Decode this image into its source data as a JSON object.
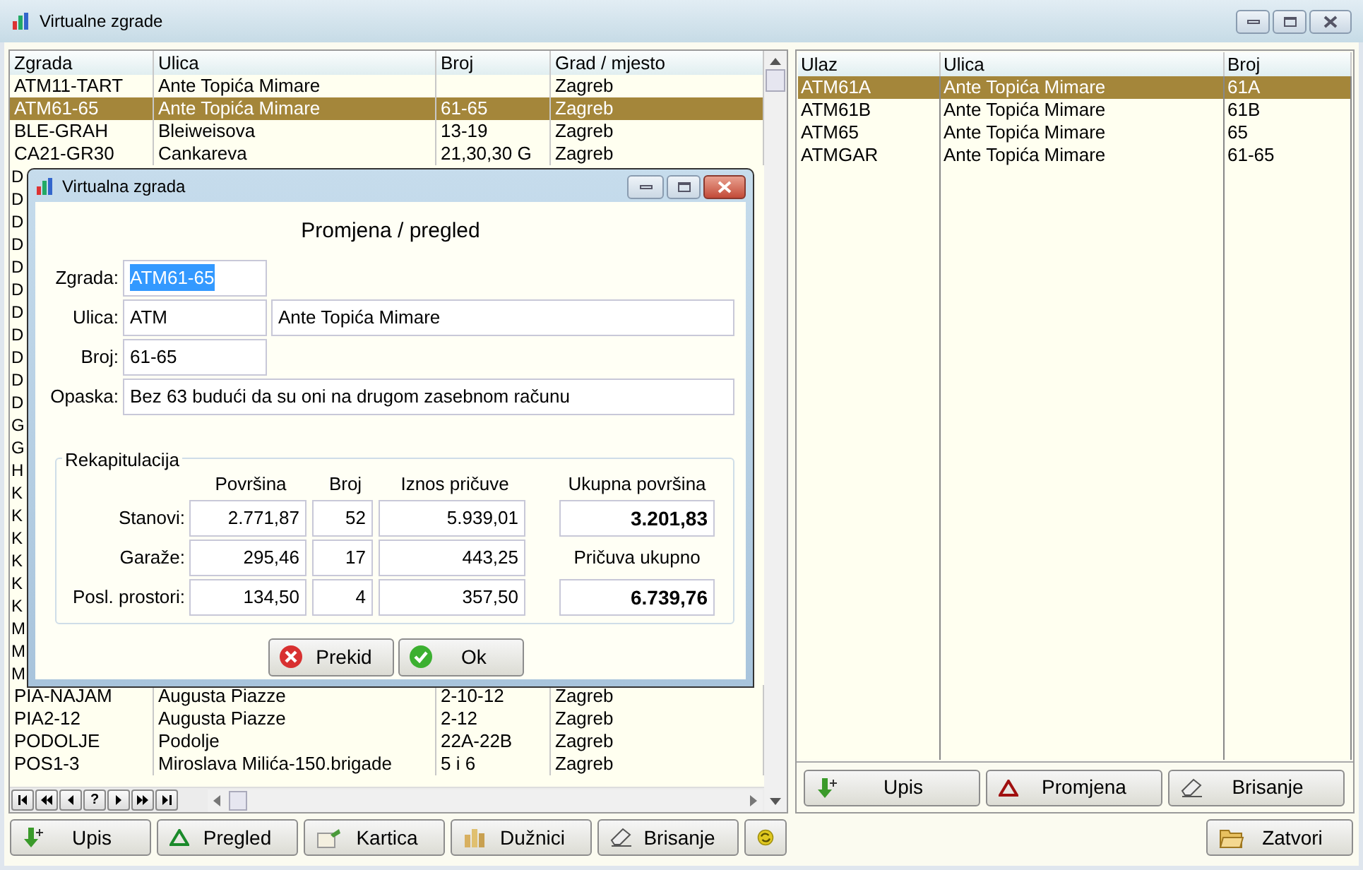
{
  "window": {
    "title": "Virtualne zgrade"
  },
  "buildings": {
    "columns": [
      "Zgrada",
      "Ulica",
      "Broj",
      "Grad / mjesto"
    ],
    "rows": [
      {
        "zgrada": "ATM11-TART",
        "ulica": "Ante Topića Mimare",
        "grad": "Zagreb",
        "selected": false
      },
      {
        "zgrada": "ATM61-65",
        "ulica": "Ante Topića Mimare",
        "broj": "61-65",
        "grad": "Zagreb",
        "selected": true
      },
      {
        "zgrada": "BLE-GRAH",
        "ulica": "Bleiweisova",
        "broj": "13-19",
        "grad": "Zagreb",
        "selected": false
      },
      {
        "zgrada": "CA21-GR30",
        "ulica": "Cankareva",
        "broj": "21,30,30 G",
        "grad": "Zagreb",
        "selected": false
      },
      {
        "zgrada": "D",
        "selected": false
      },
      {
        "zgrada": "D",
        "selected": false
      },
      {
        "zgrada": "D",
        "selected": false
      },
      {
        "zgrada": "D",
        "selected": false
      },
      {
        "zgrada": "D",
        "selected": false
      },
      {
        "zgrada": "D",
        "selected": false
      },
      {
        "zgrada": "D",
        "selected": false
      },
      {
        "zgrada": "D",
        "selected": false
      },
      {
        "zgrada": "D",
        "selected": false
      },
      {
        "zgrada": "D",
        "selected": false
      },
      {
        "zgrada": "D",
        "selected": false
      },
      {
        "zgrada": "G",
        "selected": false
      },
      {
        "zgrada": "G",
        "selected": false
      },
      {
        "zgrada": "H",
        "selected": false
      },
      {
        "zgrada": "K",
        "selected": false
      },
      {
        "zgrada": "K",
        "selected": false
      },
      {
        "zgrada": "K",
        "selected": false
      },
      {
        "zgrada": "K",
        "selected": false
      },
      {
        "zgrada": "K",
        "selected": false
      },
      {
        "zgrada": "K",
        "selected": false
      },
      {
        "zgrada": "M",
        "selected": false
      },
      {
        "zgrada": "M",
        "selected": false
      },
      {
        "zgrada": "M",
        "selected": false
      },
      {
        "zgrada": "PIA-NAJAM",
        "ulica": "Augusta Piazze",
        "broj": "2-10-12",
        "grad": "Zagreb",
        "selected": false
      },
      {
        "zgrada": "PIA2-12",
        "ulica": "Augusta Piazze",
        "broj": "2-12",
        "grad": "Zagreb",
        "selected": false
      },
      {
        "zgrada": "PODOLJE",
        "ulica": "Podolje",
        "broj": "22A-22B",
        "grad": "Zagreb",
        "selected": false
      },
      {
        "zgrada": "POS1-3",
        "ulica": "Miroslava Milića-150.brigade",
        "broj": "5 i 6",
        "grad": "Zagreb",
        "selected": false
      }
    ],
    "pager": [
      {
        "kind": "first"
      },
      {
        "kind": "prev_page"
      },
      {
        "kind": "prev"
      },
      {
        "kind": "text",
        "label": "?"
      },
      {
        "kind": "next"
      },
      {
        "kind": "next_page"
      },
      {
        "kind": "last"
      }
    ]
  },
  "entrances": {
    "columns": [
      "Ulaz",
      "Ulica",
      "Broj"
    ],
    "rows": [
      {
        "cells": [
          "ATM61A",
          "Ante Topića Mimare",
          "61A"
        ],
        "selected": true
      },
      {
        "cells": [
          "ATM61B",
          "Ante Topića Mimare",
          "61B"
        ],
        "selected": false
      },
      {
        "cells": [
          "ATM65",
          "Ante Topića Mimare",
          "65"
        ],
        "selected": false
      },
      {
        "cells": [
          "ATMGAR",
          "Ante Topića Mimare",
          "61-65"
        ],
        "selected": false
      }
    ],
    "buttons": [
      {
        "label": "Upis",
        "kind": "add"
      },
      {
        "label": "Promjena",
        "kind": "edit"
      },
      {
        "label": "Brisanje",
        "kind": "delete"
      }
    ]
  },
  "toolbar": [
    {
      "label": "Upis",
      "kind": "add"
    },
    {
      "label": "Pregled",
      "kind": "view"
    },
    {
      "label": "Kartica",
      "kind": "card"
    },
    {
      "label": "Dužnici",
      "kind": "debtors"
    },
    {
      "label": "Brisanje",
      "kind": "delete"
    },
    {
      "kind": "refresh"
    }
  ],
  "close_button": {
    "label": "Zatvori"
  },
  "dialog": {
    "title": "Virtualna zgrada",
    "heading": "Promjena / pregled",
    "fields": [
      {
        "label": "Zgrada:",
        "values": [
          "ATM61-65"
        ],
        "selected": true
      },
      {
        "label": "Ulica:",
        "values": [
          "ATM",
          "Ante Topića Mimare"
        ],
        "selected": false
      },
      {
        "label": "Broj:",
        "values": [
          "61-65"
        ],
        "selected": false
      },
      {
        "label": "Opaska:",
        "values": [
          "Bez 63 budući da su oni na drugom zasebnom računu"
        ],
        "selected": false
      }
    ],
    "recap": {
      "title": "Rekapitulacija",
      "columns": [
        "Površina",
        "Broj",
        "Iznos pričuve"
      ],
      "rows": [
        {
          "label": "Stanovi:",
          "values": [
            "2.771,87",
            "52",
            "5.939,01"
          ]
        },
        {
          "label": "Garaže:",
          "values": [
            "295,46",
            "17",
            "443,25"
          ]
        },
        {
          "label": "Posl. prostori:",
          "values": [
            "134,50",
            "4",
            "357,50"
          ]
        }
      ],
      "totals": [
        {
          "label": "Ukupna površina",
          "value": "3.201,83"
        },
        {
          "label": "Pričuva ukupno",
          "value": "6.739,76"
        }
      ]
    },
    "buttons": [
      {
        "label": "Prekid",
        "kind": "cancel"
      },
      {
        "label": "Ok",
        "kind": "ok"
      }
    ]
  }
}
